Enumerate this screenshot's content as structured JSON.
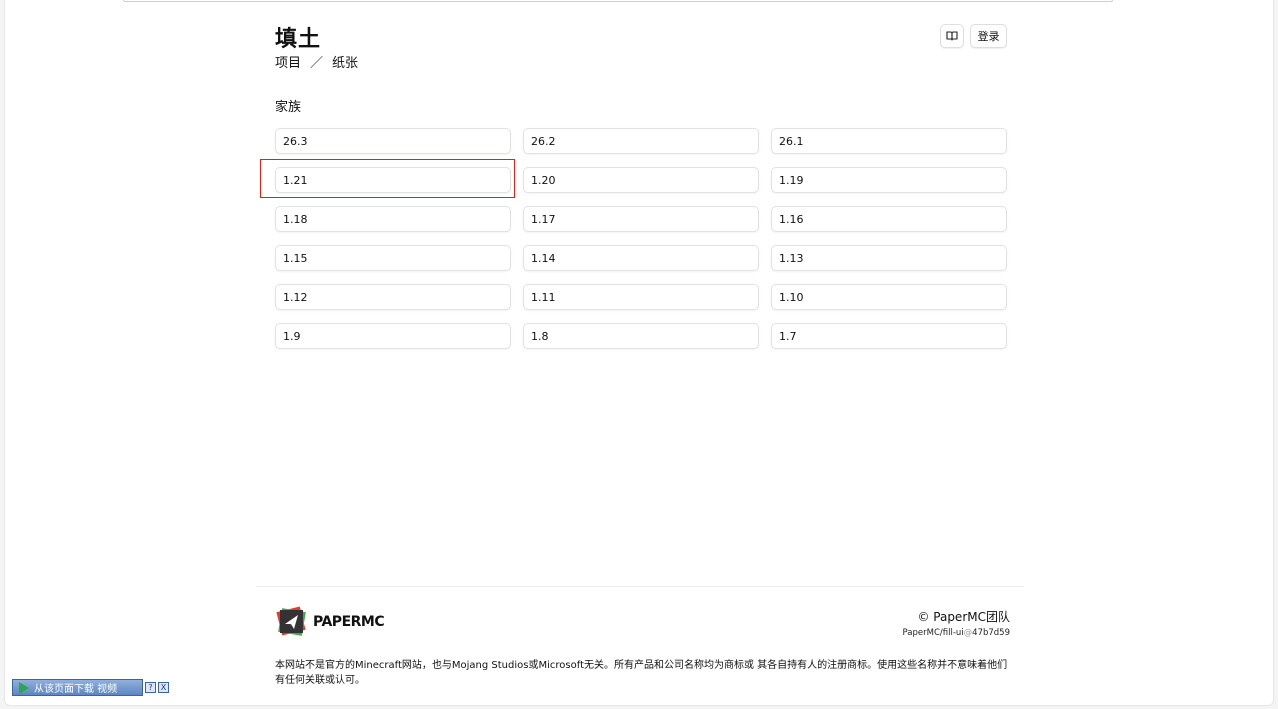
{
  "header": {
    "title": "填土",
    "breadcrumb": {
      "root": "项目",
      "separator": "／",
      "current": "纸张"
    },
    "docs_icon": "book-open-icon",
    "login_label": "登录"
  },
  "section": {
    "title": "家族",
    "versions": [
      "26.3",
      "26.2",
      "26.1",
      "1.21",
      "1.20",
      "1.19",
      "1.18",
      "1.17",
      "1.16",
      "1.15",
      "1.14",
      "1.13",
      "1.12",
      "1.11",
      "1.10",
      "1.9",
      "1.8",
      "1.7"
    ],
    "highlighted": "1.21"
  },
  "footer": {
    "logo_text": "PAPERMC",
    "copyright": "© PaperMC团队",
    "repo": "PaperMC/fill-ui",
    "repo_at": "@",
    "commit": "47b7d59",
    "disclaimer": "本网站不是官方的Minecraft网站，也与Mojang Studios或Microsoft无关。所有产品和公司名称均为商标或 其各自持有人的注册商标。使用这些名称并不意味着他们有任何关联或认可。"
  },
  "download_bar": {
    "label": "从该页面下载 视频",
    "help": "?",
    "close": "X"
  },
  "colors": {
    "highlight": "#e0221f",
    "logo_red": "#e23a2d",
    "logo_green": "#3fae49",
    "logo_dark": "#333333"
  }
}
